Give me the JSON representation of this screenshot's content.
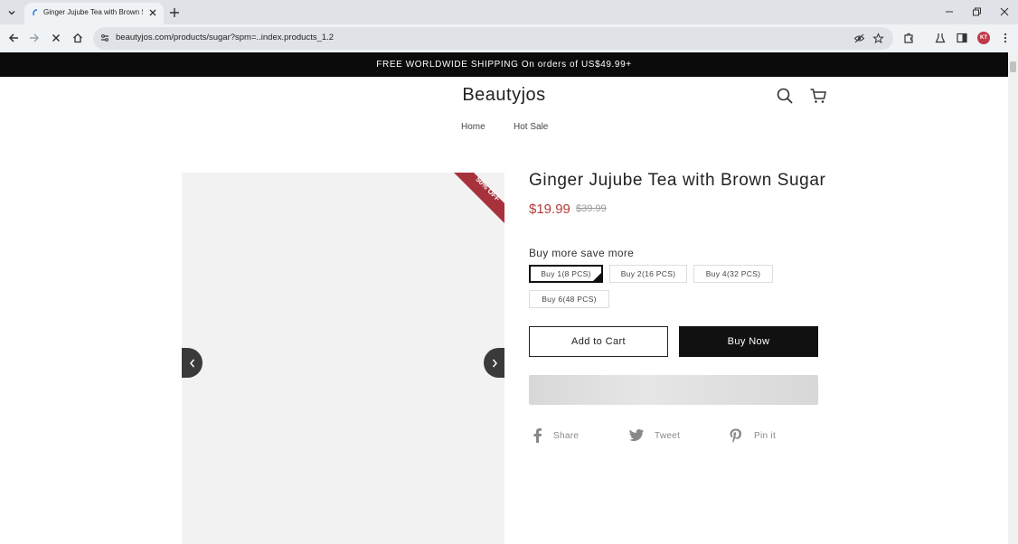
{
  "browser": {
    "tab_title": "Ginger Jujube Tea with Brown S",
    "url": "beautyjos.com/products/sugar?spm=..index.products_1.2",
    "avatar_initials": "KT"
  },
  "store": {
    "announcement": "FREE WORLDWIDE SHIPPING On orders of US$49.99+",
    "brand": "Beautyjos",
    "nav": [
      "Home",
      "Hot Sale"
    ]
  },
  "product": {
    "title": "Ginger Jujube Tea with Brown Sugar",
    "price": "$19.99",
    "compare_price": "$39.99",
    "discount_badge": "50% OFF",
    "option_label": "Buy more save more",
    "variants": [
      "Buy 1(8 PCS)",
      "Buy 2(16 PCS)",
      "Buy 4(32 PCS)",
      "Buy 6(48 PCS)"
    ],
    "selected_variant": "Buy 1(8 PCS)",
    "add_to_cart": "Add to Cart",
    "buy_now": "Buy Now"
  },
  "share": {
    "facebook": "Share",
    "twitter": "Tweet",
    "pinterest": "Pin it"
  },
  "colors": {
    "accent_price": "#b23a3a",
    "badge": "#a8323c",
    "announcement_bg": "#0b0b0b"
  }
}
